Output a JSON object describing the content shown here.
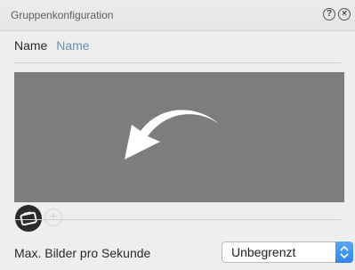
{
  "window": {
    "title": "Gruppenkonfiguration",
    "help_icon": "?",
    "close_icon": "×"
  },
  "name_field": {
    "label": "Name",
    "value": "Name"
  },
  "preview": {
    "icon": "curved-back-arrow-icon"
  },
  "snapshot": {
    "icon": "snapshot-icon",
    "add_icon": "+"
  },
  "fps": {
    "label": "Max. Bilder pro Sekunde",
    "selected": "Unbegrenzt"
  },
  "colors": {
    "preview_bg": "#7d7d7d",
    "name_value": "#6f8fb2",
    "stepper_accent": "#2f86ef"
  }
}
